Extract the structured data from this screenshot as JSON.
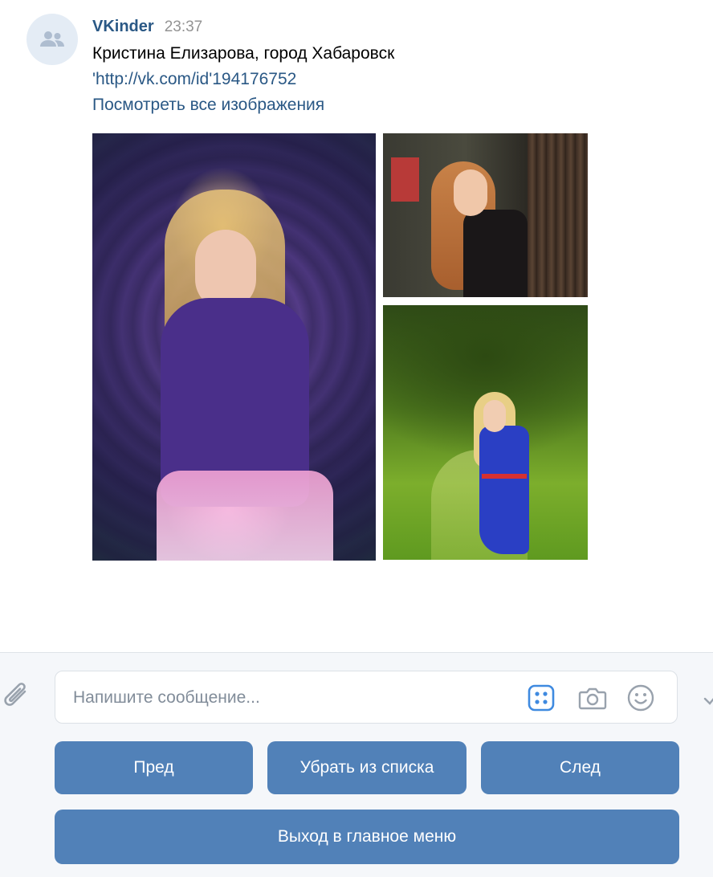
{
  "message": {
    "sender": "VKinder",
    "time": "23:37",
    "lines": [
      "Кристина Елизарова, город Хабаровск",
      "'http://vk.com/id'194176752",
      "Посмотреть все изображения"
    ],
    "avatar_icon": "users-icon"
  },
  "composer": {
    "placeholder": "Напишите сообщение...",
    "icons": [
      "paperclip-icon",
      "keyboard-icon",
      "camera-icon",
      "smile-icon"
    ]
  },
  "buttons": {
    "prev": "Пред",
    "remove": "Убрать из списка",
    "next": "След",
    "exit": "Выход в главное меню"
  },
  "colors": {
    "link": "#2a5885",
    "button": "#5181b8",
    "icon": "#99a2ad",
    "accent_icon": "#3f8ae0"
  }
}
